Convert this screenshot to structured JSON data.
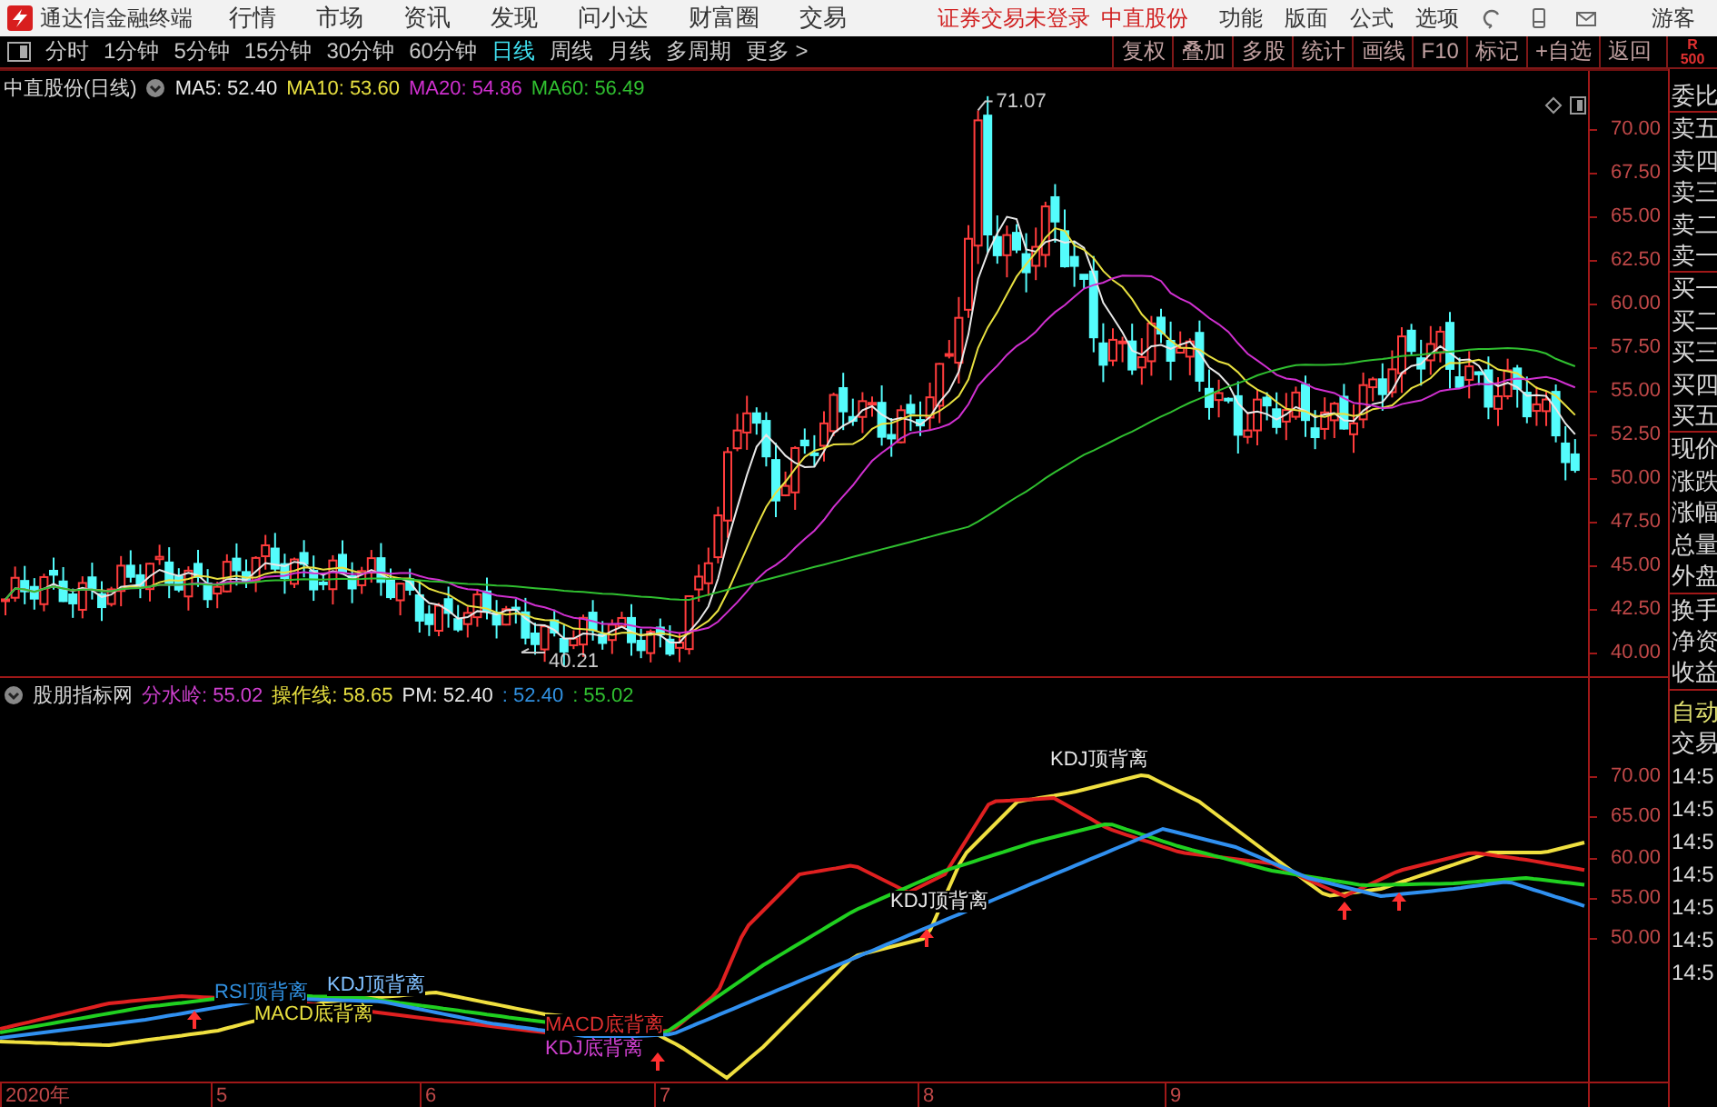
{
  "app": {
    "title": "通达信金融终端"
  },
  "menu": [
    "行情",
    "市场",
    "资讯",
    "发现",
    "问小达",
    "财富圈",
    "交易"
  ],
  "status": [
    "证券交易未登录",
    "中直股份"
  ],
  "right_menu": [
    "功能",
    "版面",
    "公式",
    "选项"
  ],
  "user": "游客",
  "periods": [
    {
      "label": "分时",
      "selected": false
    },
    {
      "label": "1分钟",
      "selected": false
    },
    {
      "label": "5分钟",
      "selected": false
    },
    {
      "label": "15分钟",
      "selected": false
    },
    {
      "label": "30分钟",
      "selected": false
    },
    {
      "label": "60分钟",
      "selected": false
    },
    {
      "label": "日线",
      "selected": true
    },
    {
      "label": "周线",
      "selected": false
    },
    {
      "label": "月线",
      "selected": false
    },
    {
      "label": "多周期",
      "selected": false
    },
    {
      "label": "更多 >",
      "selected": false
    }
  ],
  "tools": [
    "复权",
    "叠加",
    "多股",
    "统计",
    "画线",
    "F10",
    "标记",
    "+自选",
    "返回"
  ],
  "depth_badge": [
    "R",
    "500"
  ],
  "main_chart": {
    "title": "中直股份(日线)",
    "legend": [
      {
        "label": "MA5: 52.40",
        "color": "#e8e8e8"
      },
      {
        "label": "MA10: 53.60",
        "color": "#e8e040"
      },
      {
        "label": "MA20: 54.86",
        "color": "#d030d0"
      },
      {
        "label": "MA60: 56.49",
        "color": "#30c030"
      }
    ],
    "high_label": "71.07",
    "low_label": "40.21",
    "axis": [
      "70.00",
      "67.50",
      "65.00",
      "62.50",
      "60.00",
      "57.50",
      "55.00",
      "52.50",
      "50.00",
      "47.50",
      "45.00",
      "42.50",
      "40.00"
    ]
  },
  "indicator_chart": {
    "title": "股朋指标网",
    "legend": [
      {
        "label": "分水岭: 55.02",
        "color": "#d040d0"
      },
      {
        "label": "操作线: 58.65",
        "color": "#e8e040"
      },
      {
        "label": "PM: 52.40",
        "color": "#e8e8e8"
      },
      {
        "label": ": 52.40",
        "color": "#3090e0"
      },
      {
        "label": ": 55.02",
        "color": "#30c030"
      }
    ],
    "annotations": [
      {
        "text": "KDJ顶背离",
        "color": "#e8e8e8"
      },
      {
        "text": "KDJ顶背离",
        "color": "#e8e8e8"
      },
      {
        "text": "RSI顶背离",
        "color": "#3090e0"
      },
      {
        "text": "KDJ顶背离",
        "color": "#80c0ff"
      },
      {
        "text": "MACD底背离",
        "color": "#e8e040"
      },
      {
        "text": "MACD底背离",
        "color": "#e03030"
      },
      {
        "text": "KDJ底背离",
        "color": "#d040d0"
      }
    ],
    "axis": [
      "70.00",
      "65.00",
      "60.00",
      "55.00",
      "50.00"
    ]
  },
  "time_axis": [
    "2020年",
    "5",
    "6",
    "7",
    "8",
    "9"
  ],
  "quote_panel": [
    [
      "委比"
    ],
    [
      "卖五",
      "卖四",
      "卖三",
      "卖二",
      "卖一"
    ],
    [
      "买一",
      "买二",
      "买三",
      "买四",
      "买五"
    ],
    [
      "现价",
      "涨跌",
      "涨幅",
      "总量",
      "外盘"
    ],
    [
      "换手",
      "净资",
      "收益"
    ]
  ],
  "auto_trade": [
    "自动",
    "交易"
  ],
  "ticks": [
    "14:5",
    "14:5",
    "14:5",
    "14:5",
    "14:5",
    "14:5",
    "14:5"
  ]
}
